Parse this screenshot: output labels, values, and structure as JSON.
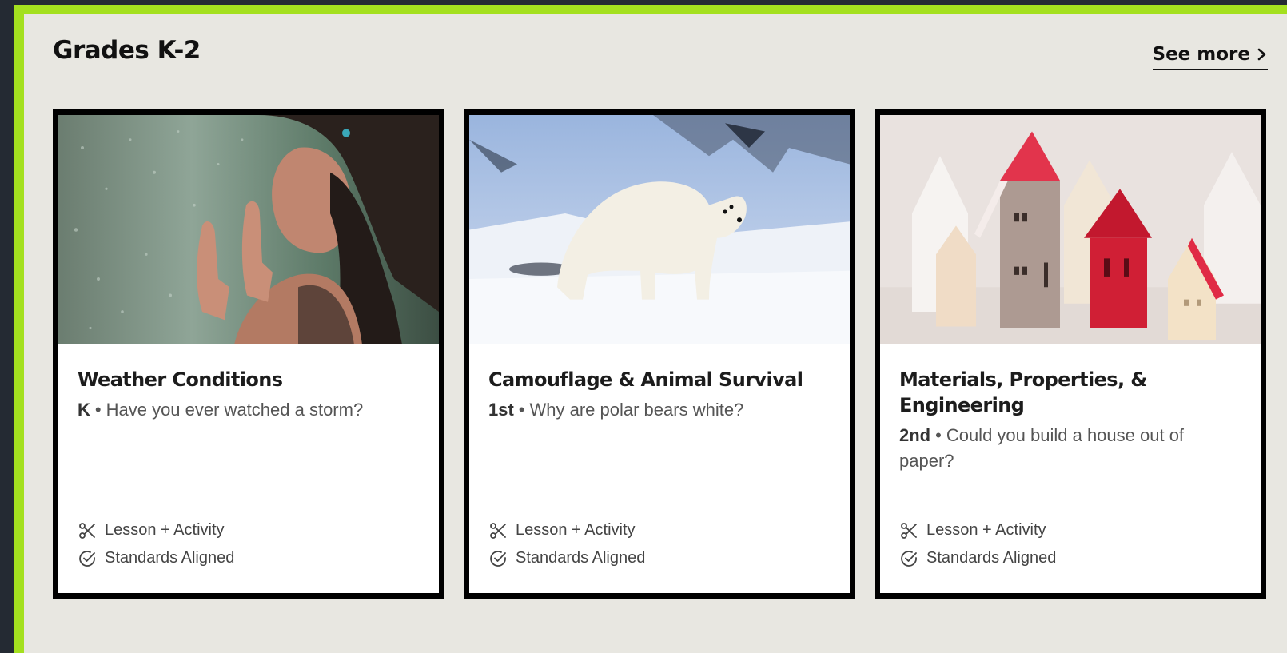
{
  "section": {
    "title": "Grades K-2",
    "see_more_label": "See more"
  },
  "cards": [
    {
      "title": "Weather Conditions",
      "grade": "K",
      "separator": "•",
      "question": "Have you ever watched a storm?",
      "features": [
        "Lesson + Activity",
        "Standards Aligned"
      ],
      "image": "girl-at-rainy-window"
    },
    {
      "title": "Camouflage & Animal Survival",
      "grade": "1st",
      "separator": "•",
      "question": "Why are polar bears white?",
      "features": [
        "Lesson + Activity",
        "Standards Aligned"
      ],
      "image": "polar-bear-on-snow"
    },
    {
      "title": "Materials, Properties, & Engineering",
      "grade": "2nd",
      "separator": "•",
      "question": "Could you build a house out of paper?",
      "features": [
        "Lesson + Activity",
        "Standards Aligned"
      ],
      "image": "paper-houses"
    }
  ],
  "icons": {
    "see_more": "chevron-right-icon",
    "lesson": "scissors-icon",
    "standards": "check-circle-icon"
  },
  "colors": {
    "accent_border": "#a4e01f",
    "panel_background": "#e8e7e1",
    "outer_background": "#242a33"
  }
}
